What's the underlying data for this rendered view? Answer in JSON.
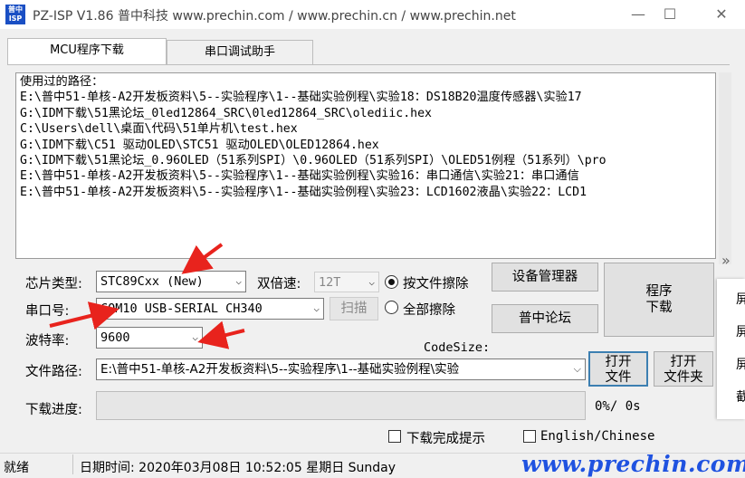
{
  "window": {
    "icon_text": "普中\nISP",
    "title": "PZ-ISP V1.86 普中科技 www.prechin.com / www.prechin.cn / www.prechin.net",
    "minimize": "—",
    "maximize": "☐",
    "close": "✕"
  },
  "tabs": [
    {
      "label": "MCU程序下载"
    },
    {
      "label": "串口调试助手"
    }
  ],
  "log": {
    "text": "使用过的路径：\nE:\\普中51-单核-A2开发板资料\\5--实验程序\\1--基础实验例程\\实验18：DS18B20温度传感器\\实验17\nG:\\IDM下载\\51黑论坛_0led12864_SRC\\0led12864_SRC\\olediic.hex\nC:\\Users\\dell\\桌面\\代码\\51单片机\\test.hex\nG:\\IDM下载\\C51 驱动OLED\\STC51 驱动OLED\\OLED12864.hex\nG:\\IDM下载\\51黑论坛_0.96OLED（51系列SPI）\\0.96OLED（51系列SPI）\\OLED51例程（51系列）\\pro\nE:\\普中51-单核-A2开发板资料\\5--实验程序\\1--基础实验例程\\实验16：串口通信\\实验21：串口通信\nE:\\普中51-单核-A2开发板资料\\5--实验程序\\1--基础实验例程\\实验23：LCD1602液晶\\实验22：LCD1"
  },
  "form": {
    "chip_label": "芯片类型:",
    "chip_value": "STC89Cxx (New)",
    "double_speed_label": "双倍速:",
    "double_speed_value": "12T",
    "erase_by_file": "按文件擦除",
    "erase_all": "全部擦除",
    "port_label": "串口号:",
    "port_value": "COM10  USB-SERIAL CH340",
    "scan_button": "扫描",
    "baud_label": "波特率:",
    "baud_value": "9600",
    "codesize_label": "CodeSize:",
    "path_label": "文件路径:",
    "path_value": "E:\\普中51-单核-A2开发板资料\\5--实验程序\\1--基础实验例程\\实验",
    "progress_label": "下载进度:",
    "progress_fraction": 0,
    "progress_text": "0%/ 0s",
    "device_manager_button": "设备管理器",
    "forum_button": "普中论坛",
    "program_download_line1": "程序",
    "program_download_line2": "下载",
    "open_file_line1": "打开",
    "open_file_line2": "文件",
    "open_folder_line1": "打开",
    "open_folder_line2": "文件夹",
    "download_done_prompt": "下载完成提示",
    "language_toggle": "English/Chinese"
  },
  "side_panel": {
    "chevron": "»",
    "items": [
      "屏",
      "屏",
      "屏",
      "截"
    ]
  },
  "statusbar": {
    "status": "就绪",
    "datetime": "日期时间:  2020年03月08日  10:52:05  星期日  Sunday",
    "brand": "www.prechin.com"
  },
  "colors": {
    "annotation_arrow": "#e8231d",
    "brand_blue": "#1f52e0",
    "focus_blue": "#3c7fb1"
  }
}
